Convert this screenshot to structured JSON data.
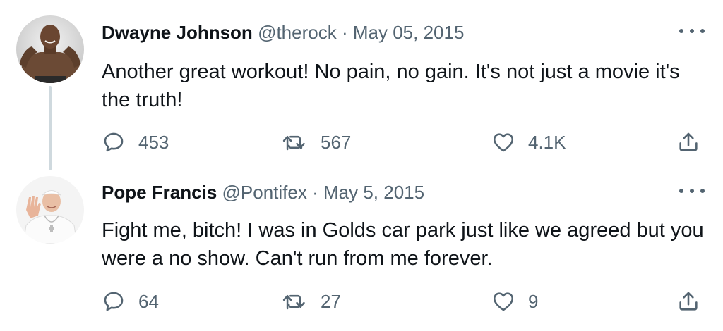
{
  "tweets": [
    {
      "author_name": "Dwayne Johnson",
      "handle": "@therock",
      "separator": "·",
      "date": "May 05, 2015",
      "text": "Another great workout! No pain, no gain. It's not just a movie it's the truth!",
      "replies": "453",
      "retweets": "567",
      "likes": "4.1K",
      "avatar_icon": "dwayne-johnson-avatar"
    },
    {
      "author_name": "Pope Francis",
      "handle": "@Pontifex",
      "separator": "·",
      "date": "May 5, 2015",
      "text": "Fight me, bitch! I was in Golds car park just like we agreed but you were a no show. Can't run from me forever.",
      "replies": "64",
      "retweets": "27",
      "likes": "9",
      "avatar_icon": "pope-francis-avatar"
    }
  ],
  "icons": {
    "reply": "reply-icon",
    "retweet": "retweet-icon",
    "like": "heart-icon",
    "share": "share-icon",
    "more": "more-icon"
  },
  "colors": {
    "text_primary": "#0f1419",
    "text_secondary": "#536471",
    "thread_line": "#cfd9de"
  }
}
